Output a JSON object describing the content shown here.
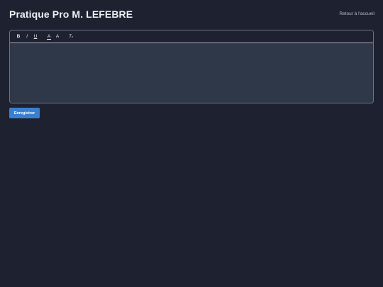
{
  "header": {
    "title": "Pratique Pro M. LEFEBRE",
    "home_link": "Retour à l'accueil"
  },
  "toolbar": {
    "bold": "B",
    "italic": "I",
    "underline": "U",
    "text_color": "A",
    "background_color": "A",
    "clear_format": "T"
  },
  "editor": {
    "content": ""
  },
  "actions": {
    "save_label": "Enregistrer"
  },
  "colors": {
    "background": "#1e2230",
    "editor_background": "#2e3849",
    "accent": "#3a80d2"
  }
}
